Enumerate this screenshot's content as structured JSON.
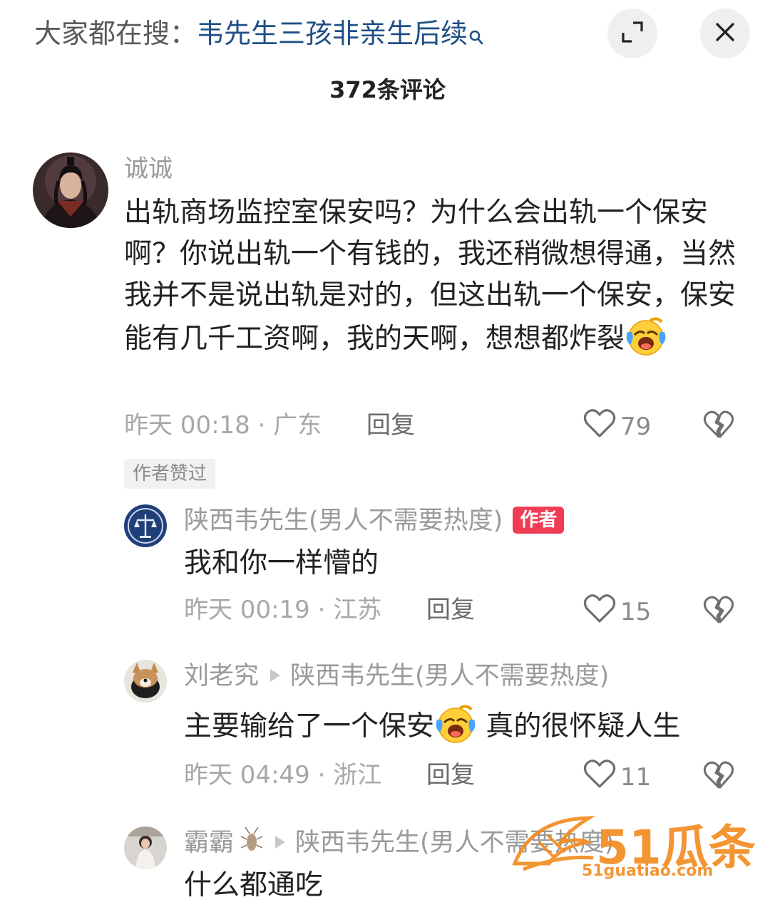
{
  "header": {
    "search_prefix": "大家都在搜：",
    "search_term": "韦先生三孩非亲生后续",
    "comment_count": "372条评论"
  },
  "icons": {
    "search": "search-icon",
    "expand": "expand-icon",
    "close": "close-icon",
    "like": "heart-outline-icon",
    "dislike": "broken-heart-icon",
    "emoji": "laughing-crying-emoji"
  },
  "colors": {
    "author_badge": "#f03d54",
    "search_term": "#1f4f86",
    "watermark": "#f28a1e"
  },
  "comments": [
    {
      "username": "诚诚",
      "text": "出轨商场监控室保安吗？为什么会出轨一个保安啊？你说出轨一个有钱的，我还稍微想得通，当然我并不是说出轨是对的，但这出轨一个保安，保安能有几千工资啊，我的天啊，想想都炸裂",
      "time": "昨天 00:18 · 广东",
      "reply": "回复",
      "likes": "79",
      "author_liked": "作者赞过"
    },
    {
      "username": "陕西韦先生(男人不需要热度)",
      "author_badge": "作者",
      "text": "我和你一样懵的",
      "time": "昨天 00:19 · 江苏",
      "reply": "回复",
      "likes": "15"
    },
    {
      "username": "刘老究",
      "reply_to": "陕西韦先生(男人不需要热度)",
      "text_part1": "主要输给了一个保安",
      "text_part2": " 真的很怀疑人生",
      "time": "昨天 04:49 · 浙江",
      "reply": "回复",
      "likes": "11"
    },
    {
      "username": "霸霸",
      "reply_to": "陕西韦先生(男人不需要热度)",
      "text": "什么都通吃"
    }
  ],
  "watermark": {
    "brand": "51瓜条",
    "url": "51guatiao.com"
  }
}
